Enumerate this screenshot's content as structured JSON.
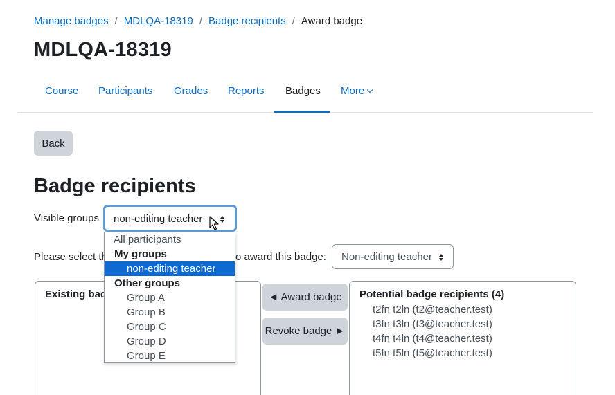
{
  "breadcrumb": {
    "items": [
      "Manage badges",
      "MDLQA-18319",
      "Badge recipients"
    ],
    "current": "Award badge",
    "separator": "/"
  },
  "page_title": "MDLQA-18319",
  "nav": {
    "tabs": [
      "Course",
      "Participants",
      "Grades",
      "Reports",
      "Badges",
      "More"
    ],
    "active": "Badges"
  },
  "back_label": "Back",
  "heading": "Badge recipients",
  "groups": {
    "label": "Visible groups",
    "selected": "non-editing teacher",
    "options": {
      "all": "All participants",
      "my_groups_label": "My groups",
      "my_groups": [
        "non-editing teacher"
      ],
      "other_groups_label": "Other groups",
      "other_groups": [
        "Group A",
        "Group B",
        "Group C",
        "Group D",
        "Group E"
      ]
    }
  },
  "instruction": {
    "left": "Please select th",
    "right": "o award this badge:"
  },
  "role_select": {
    "selected": "Non-editing teacher"
  },
  "existing": {
    "title": "Existing bad"
  },
  "buttons": {
    "award": "◄ Award badge",
    "revoke": "Revoke badge ►"
  },
  "potential": {
    "title": "Potential badge recipients (4)",
    "users": [
      "t2fn t2ln (t2@teacher.test)",
      "t3fn t3ln (t3@teacher.test)",
      "t4fn t4ln (t4@teacher.test)",
      "t5fn t5ln (t5@teacher.test)"
    ]
  },
  "colors": {
    "link": "#0f6cbf",
    "button_bg": "#ced4da",
    "focus_border": "#5f9bd5",
    "selected_option": "#0e6ad1"
  },
  "icons": {
    "select_arrows": "select-arrows-icon",
    "nav_more_chevron": "chevron-down-icon",
    "mouse_cursor": "cursor-icon"
  }
}
